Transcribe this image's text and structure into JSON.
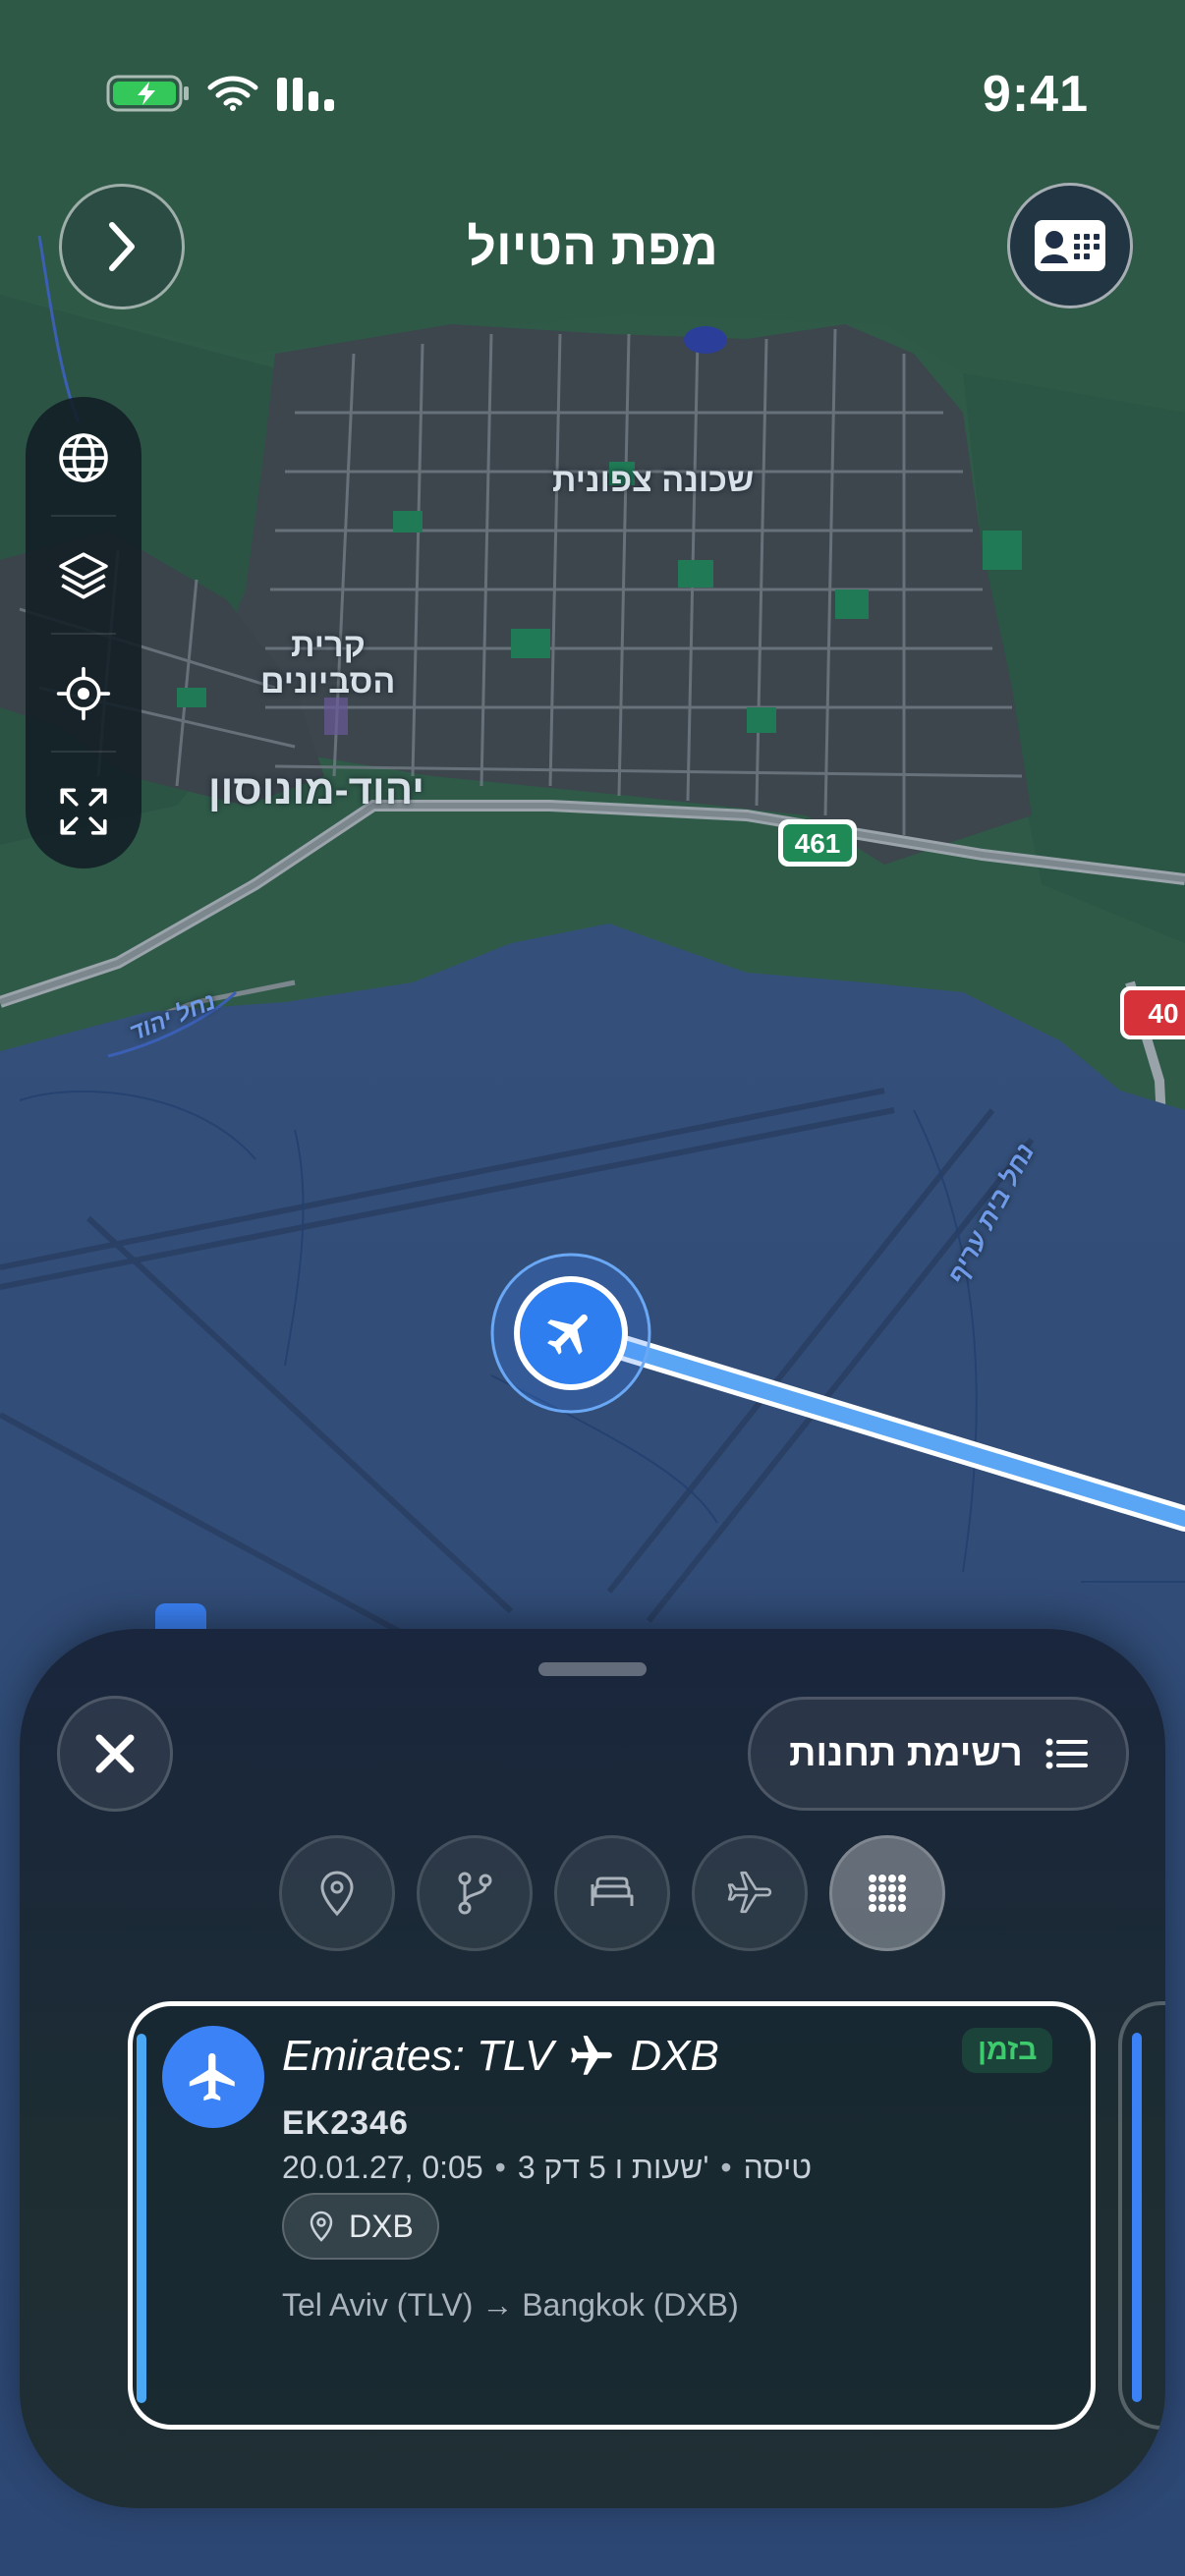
{
  "status_bar": {
    "time": "9:41",
    "icons": [
      "battery-charging-icon",
      "wifi-icon",
      "signal-icon"
    ]
  },
  "header": {
    "title": "מפת הטיול",
    "back_icon": "chevron-right-icon",
    "card_icon": "boarding-pass-icon"
  },
  "map_tools": [
    "globe-icon",
    "layers-icon",
    "locate-icon",
    "expand-icon"
  ],
  "map": {
    "labels": {
      "north_neighborhood": "שכונה צפונית",
      "kiryat_line1": "קרית",
      "kiryat_line2": "הסביונים",
      "yehud": "יהוד-מונוסון",
      "stream_yehud": "נחל יהוד",
      "stream_beit_arif": "נחל בית עריף",
      "road_461": "461",
      "road_40": "40"
    },
    "airport_marker": "airplane-icon",
    "route_color": "#5aa6f5"
  },
  "sheet": {
    "close_icon": "close-icon",
    "stops_button": "רשימת תחנות",
    "stops_icon": "list-icon",
    "filters": [
      {
        "icon": "location-pin-icon",
        "active": false
      },
      {
        "icon": "route-branch-icon",
        "active": false
      },
      {
        "icon": "bed-icon",
        "active": false
      },
      {
        "icon": "airplane-icon",
        "active": false
      },
      {
        "icon": "grid-dots-icon",
        "active": true
      }
    ],
    "flight": {
      "title_prefix": "Emirates: TLV",
      "title_suffix": "DXB",
      "status": "בזמן",
      "flight_number": "EK2346",
      "type": "טיסה",
      "duration": "3 שעות ו 5 דק'",
      "datetime": "20.01.27, 0:05",
      "separator": "•",
      "location_chip": "DXB",
      "route": "Tel Aviv (TLV) → Bangkok (DXB)"
    },
    "colors": {
      "accent": "#3b82f6",
      "on_time": "#3ecb6e"
    }
  }
}
